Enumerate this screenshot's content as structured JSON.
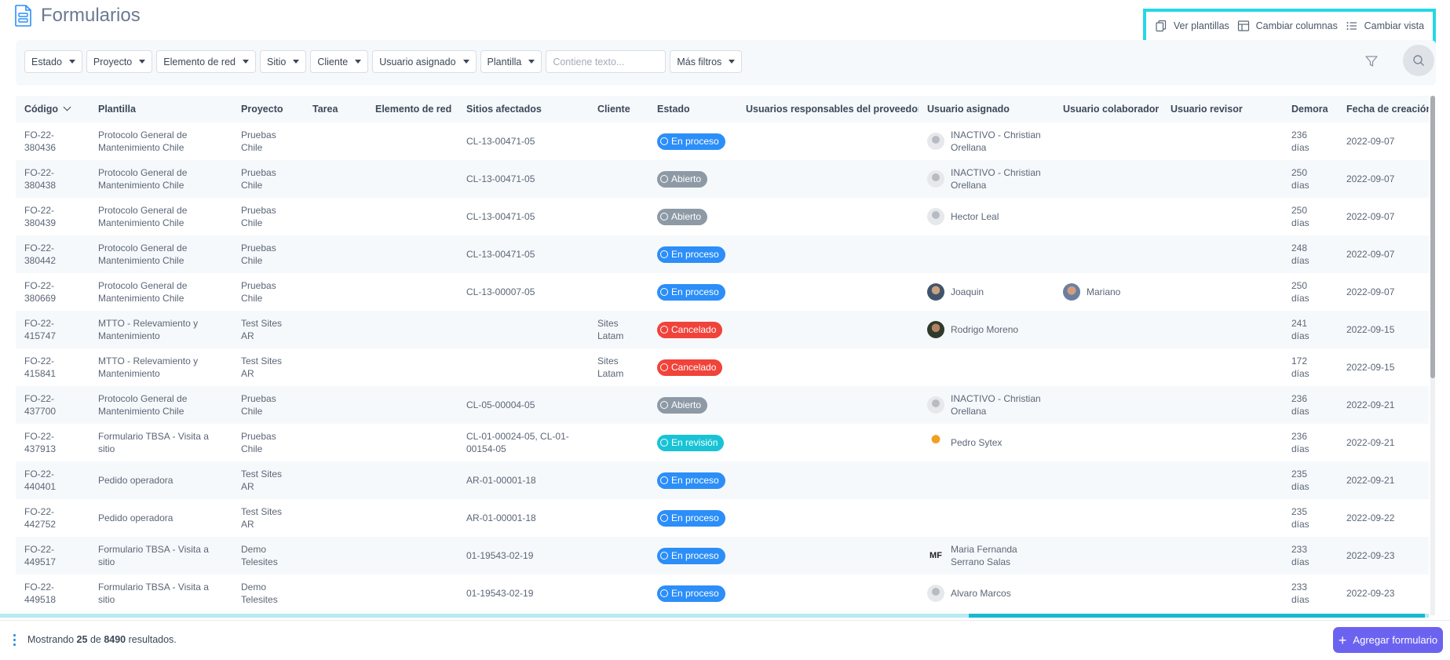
{
  "header": {
    "title": "Formularios",
    "actions": [
      {
        "label": "Ver plantillas",
        "icon": "copy-icon"
      },
      {
        "label": "Cambiar columnas",
        "icon": "columns-icon"
      },
      {
        "label": "Cambiar vista",
        "icon": "list-icon"
      }
    ],
    "highlight_color": "#26d7e6"
  },
  "filters": {
    "buttons": [
      "Estado",
      "Proyecto",
      "Elemento de red",
      "Sitio",
      "Cliente",
      "Usuario asignado",
      "Plantilla"
    ],
    "text_placeholder": "Contiene texto...",
    "more": "Más filtros"
  },
  "table": {
    "columns": [
      "Código",
      "Plantilla",
      "Proyecto",
      "Tarea",
      "Elemento de red",
      "Sitios afectados",
      "Cliente",
      "Estado",
      "Usuarios responsables del proveedor",
      "Usuario asignado",
      "Usuario colaborador",
      "Usuario revisor",
      "Demora",
      "Fecha de creación"
    ],
    "rows": [
      {
        "codigo_a": "FO-22-",
        "codigo_b": "380436",
        "plantilla_a": "Protocolo General de",
        "plantilla_b": "Mantenimiento Chile",
        "proyecto_a": "Pruebas",
        "proyecto_b": "Chile",
        "tarea": "",
        "elemento": "",
        "sitios_a": "CL-13-00471-05",
        "sitios_b": "",
        "cliente_a": "",
        "cliente_b": "",
        "estado": "En proceso",
        "responsables": "",
        "asignado_a": "INACTIVO - Christian",
        "asignado_b": "Orellana",
        "colaborador": "",
        "revisor": "",
        "demora_a": "236",
        "demora_b": "días",
        "fecha": "2022-09-07"
      },
      {
        "codigo_a": "FO-22-",
        "codigo_b": "380438",
        "plantilla_a": "Protocolo General de",
        "plantilla_b": "Mantenimiento Chile",
        "proyecto_a": "Pruebas",
        "proyecto_b": "Chile",
        "tarea": "",
        "elemento": "",
        "sitios_a": "CL-13-00471-05",
        "sitios_b": "",
        "cliente_a": "",
        "cliente_b": "",
        "estado": "Abierto",
        "responsables": "",
        "asignado_a": "INACTIVO - Christian",
        "asignado_b": "Orellana",
        "colaborador": "",
        "revisor": "",
        "demora_a": "250",
        "demora_b": "días",
        "fecha": "2022-09-07"
      },
      {
        "codigo_a": "FO-22-",
        "codigo_b": "380439",
        "plantilla_a": "Protocolo General de",
        "plantilla_b": "Mantenimiento Chile",
        "proyecto_a": "Pruebas",
        "proyecto_b": "Chile",
        "tarea": "",
        "elemento": "",
        "sitios_a": "CL-13-00471-05",
        "sitios_b": "",
        "cliente_a": "",
        "cliente_b": "",
        "estado": "Abierto",
        "responsables": "",
        "asignado_a": "Hector Leal",
        "asignado_b": "",
        "colaborador": "",
        "revisor": "",
        "demora_a": "250",
        "demora_b": "días",
        "fecha": "2022-09-07"
      },
      {
        "codigo_a": "FO-22-",
        "codigo_b": "380442",
        "plantilla_a": "Protocolo General de",
        "plantilla_b": "Mantenimiento Chile",
        "proyecto_a": "Pruebas",
        "proyecto_b": "Chile",
        "tarea": "",
        "elemento": "",
        "sitios_a": "CL-13-00471-05",
        "sitios_b": "",
        "cliente_a": "",
        "cliente_b": "",
        "estado": "En proceso",
        "responsables": "",
        "asignado_a": "",
        "asignado_b": "",
        "colaborador": "",
        "revisor": "",
        "demora_a": "248",
        "demora_b": "días",
        "fecha": "2022-09-07"
      },
      {
        "codigo_a": "FO-22-",
        "codigo_b": "380669",
        "plantilla_a": "Protocolo General de",
        "plantilla_b": "Mantenimiento Chile",
        "proyecto_a": "Pruebas",
        "proyecto_b": "Chile",
        "tarea": "",
        "elemento": "",
        "sitios_a": "CL-13-00007-05",
        "sitios_b": "",
        "cliente_a": "",
        "cliente_b": "",
        "estado": "En proceso",
        "responsables": "",
        "asignado_a": "Joaquin",
        "asignado_b": "",
        "colaborador": "Mariano",
        "revisor": "",
        "demora_a": "250",
        "demora_b": "días",
        "fecha": "2022-09-07"
      },
      {
        "codigo_a": "FO-22-",
        "codigo_b": "415747",
        "plantilla_a": "MTTO - Relevamiento y",
        "plantilla_b": "Mantenimiento",
        "proyecto_a": "Test Sites",
        "proyecto_b": "AR",
        "tarea": "",
        "elemento": "",
        "sitios_a": "",
        "sitios_b": "",
        "cliente_a": "Sites",
        "cliente_b": "Latam",
        "estado": "Cancelado",
        "responsables": "",
        "asignado_a": "Rodrigo Moreno",
        "asignado_b": "",
        "colaborador": "",
        "revisor": "",
        "demora_a": "241",
        "demora_b": "días",
        "fecha": "2022-09-15"
      },
      {
        "codigo_a": "FO-22-",
        "codigo_b": "415841",
        "plantilla_a": "MTTO - Relevamiento y",
        "plantilla_b": "Mantenimiento",
        "proyecto_a": "Test Sites",
        "proyecto_b": "AR",
        "tarea": "",
        "elemento": "",
        "sitios_a": "",
        "sitios_b": "",
        "cliente_a": "Sites",
        "cliente_b": "Latam",
        "estado": "Cancelado",
        "responsables": "",
        "asignado_a": "",
        "asignado_b": "",
        "colaborador": "",
        "revisor": "",
        "demora_a": "172",
        "demora_b": "días",
        "fecha": "2022-09-15"
      },
      {
        "codigo_a": "FO-22-",
        "codigo_b": "437700",
        "plantilla_a": "Protocolo General de",
        "plantilla_b": "Mantenimiento Chile",
        "proyecto_a": "Pruebas",
        "proyecto_b": "Chile",
        "tarea": "",
        "elemento": "",
        "sitios_a": "CL-05-00004-05",
        "sitios_b": "",
        "cliente_a": "",
        "cliente_b": "",
        "estado": "Abierto",
        "responsables": "",
        "asignado_a": "INACTIVO - Christian",
        "asignado_b": "Orellana",
        "colaborador": "",
        "revisor": "",
        "demora_a": "236",
        "demora_b": "días",
        "fecha": "2022-09-21"
      },
      {
        "codigo_a": "FO-22-",
        "codigo_b": "437913",
        "plantilla_a": "Formulario TBSA - Visita a",
        "plantilla_b": "sitio",
        "proyecto_a": "Pruebas",
        "proyecto_b": "Chile",
        "tarea": "",
        "elemento": "",
        "sitios_a": "CL-01-00024-05, CL-01-",
        "sitios_b": "00154-05",
        "cliente_a": "",
        "cliente_b": "",
        "estado": "En revisión",
        "responsables": "",
        "asignado_a": "Pedro Sytex",
        "asignado_b": "",
        "colaborador": "",
        "revisor": "",
        "demora_a": "236",
        "demora_b": "días",
        "fecha": "2022-09-21"
      },
      {
        "codigo_a": "FO-22-",
        "codigo_b": "440401",
        "plantilla_a": "Pedido operadora",
        "plantilla_b": "",
        "proyecto_a": "Test Sites",
        "proyecto_b": "AR",
        "tarea": "",
        "elemento": "",
        "sitios_a": "AR-01-00001-18",
        "sitios_b": "",
        "cliente_a": "",
        "cliente_b": "",
        "estado": "En proceso",
        "responsables": "",
        "asignado_a": "",
        "asignado_b": "",
        "colaborador": "",
        "revisor": "",
        "demora_a": "235",
        "demora_b": "días",
        "fecha": "2022-09-21"
      },
      {
        "codigo_a": "FO-22-",
        "codigo_b": "442752",
        "plantilla_a": "Pedido operadora",
        "plantilla_b": "",
        "proyecto_a": "Test Sites",
        "proyecto_b": "AR",
        "tarea": "",
        "elemento": "",
        "sitios_a": "AR-01-00001-18",
        "sitios_b": "",
        "cliente_a": "",
        "cliente_b": "",
        "estado": "En proceso",
        "responsables": "",
        "asignado_a": "",
        "asignado_b": "",
        "colaborador": "",
        "revisor": "",
        "demora_a": "235",
        "demora_b": "días",
        "fecha": "2022-09-22"
      },
      {
        "codigo_a": "FO-22-",
        "codigo_b": "449517",
        "plantilla_a": "Formulario TBSA - Visita a",
        "plantilla_b": "sitio",
        "proyecto_a": "Demo",
        "proyecto_b": "Telesites",
        "tarea": "",
        "elemento": "",
        "sitios_a": "01-19543-02-19",
        "sitios_b": "",
        "cliente_a": "",
        "cliente_b": "",
        "estado": "En proceso",
        "responsables": "",
        "asignado_a": "Maria Fernanda",
        "asignado_b": "Serrano Salas",
        "colaborador": "",
        "revisor": "",
        "demora_a": "233",
        "demora_b": "días",
        "fecha": "2022-09-23"
      },
      {
        "codigo_a": "FO-22-",
        "codigo_b": "449518",
        "plantilla_a": "Formulario TBSA - Visita a",
        "plantilla_b": "sitio",
        "proyecto_a": "Demo",
        "proyecto_b": "Telesites",
        "tarea": "",
        "elemento": "",
        "sitios_a": "01-19543-02-19",
        "sitios_b": "",
        "cliente_a": "",
        "cliente_b": "",
        "estado": "En proceso",
        "responsables": "",
        "asignado_a": "Alvaro Marcos",
        "asignado_b": "",
        "colaborador": "",
        "revisor": "",
        "demora_a": "233",
        "demora_b": "días",
        "fecha": "2022-09-23"
      }
    ],
    "avatars": {
      "gray": "person-placeholder-icon",
      "initials_maria": "MF"
    },
    "status_colors": {
      "En proceso": "#2c8ef8",
      "Abierto": "#8d9aa6",
      "Cancelado": "#f0433a",
      "En revisión": "#18c3d6"
    }
  },
  "footer": {
    "results_prefix": "Mostrando",
    "shown": "25",
    "of": "de",
    "total": "8490",
    "results_suffix": "resultados.",
    "add_button": "Agregar formulario",
    "accent": "#6b63f0"
  }
}
